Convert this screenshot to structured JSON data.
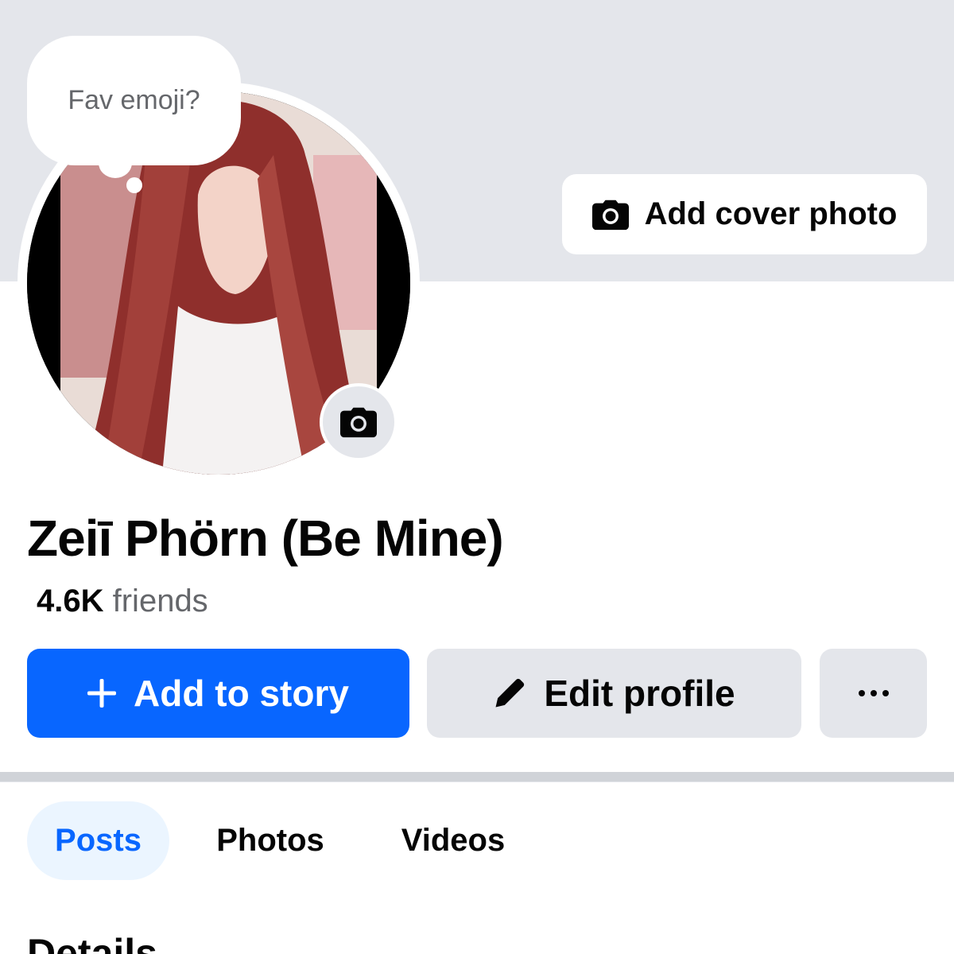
{
  "cover": {
    "add_cover_label": "Add cover photo",
    "camera_icon": "camera-icon",
    "background_color": "#e4e6eb"
  },
  "bubble": {
    "text": "Fav emoji?"
  },
  "profile": {
    "name": "Zeiī Phörn (Be Mine)",
    "friends_count": "4.6K",
    "friends_label": "friends",
    "avatar_camera_icon": "camera-icon"
  },
  "actions": {
    "add_story_label": "Add to story",
    "add_story_icon": "plus-icon",
    "edit_profile_label": "Edit profile",
    "edit_profile_icon": "pencil-icon",
    "more_label": "···",
    "accent_color": "#0866ff"
  },
  "tabs": [
    {
      "label": "Posts",
      "selected": true
    },
    {
      "label": "Photos",
      "selected": false
    },
    {
      "label": "Videos",
      "selected": false
    }
  ],
  "section": {
    "title": "Details"
  }
}
